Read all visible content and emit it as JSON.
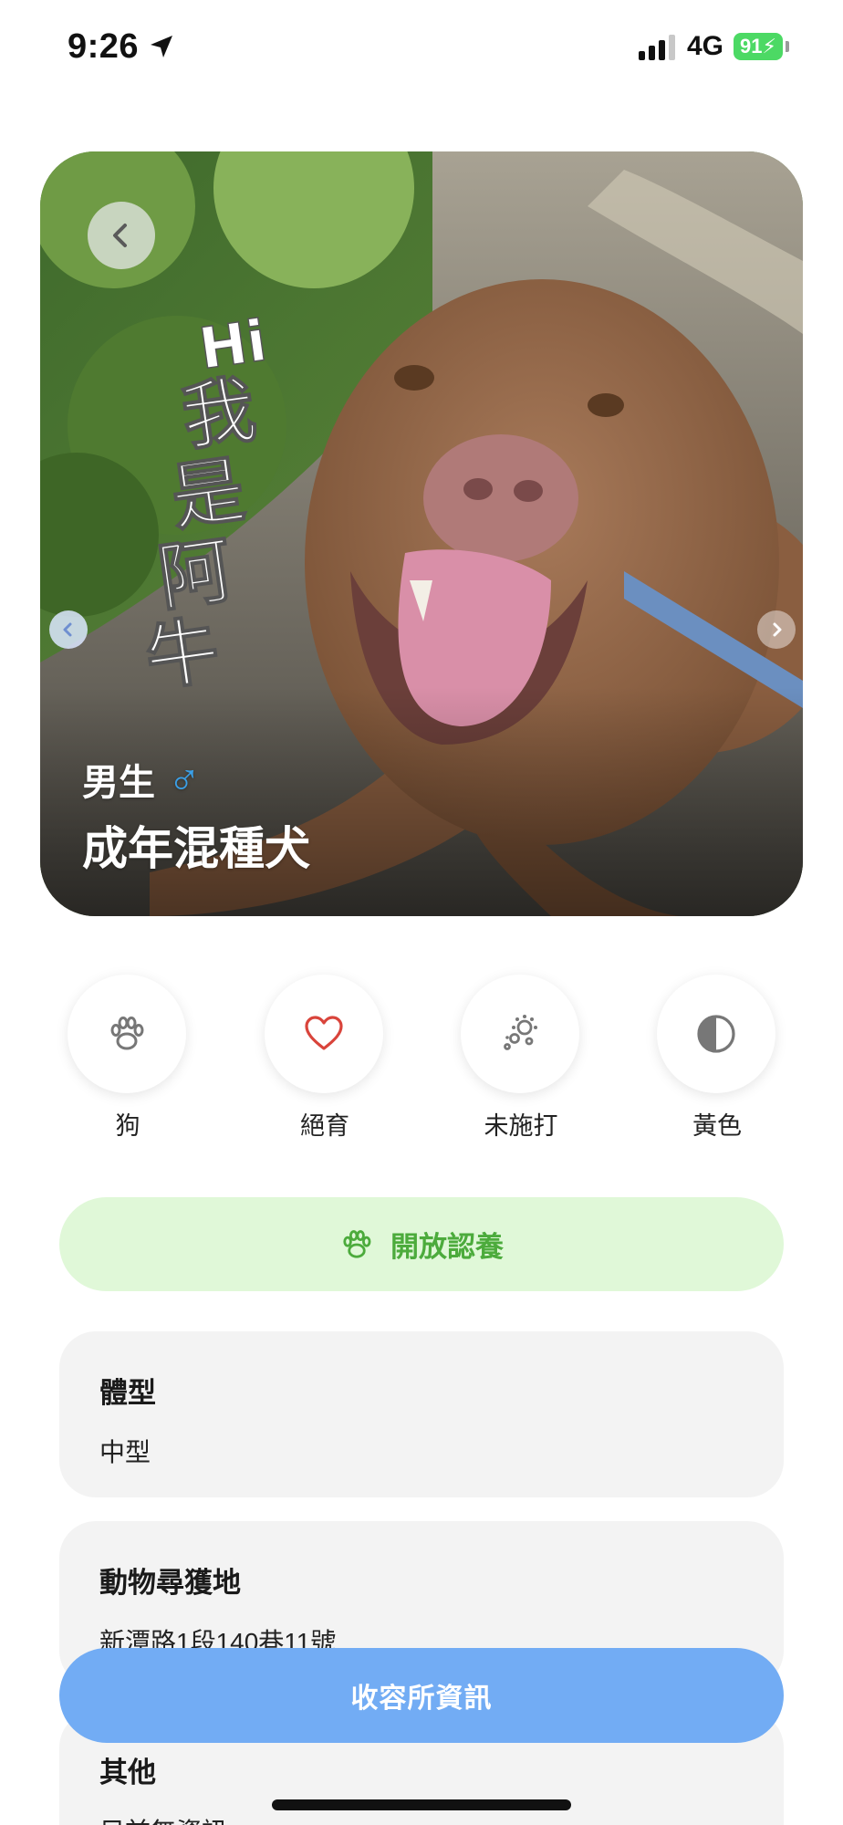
{
  "status_bar": {
    "time": "9:26",
    "network": "4G",
    "battery": "91"
  },
  "hero": {
    "sex": "男生",
    "sex_symbol": "♂",
    "title": "成年混種犬",
    "photo_text": [
      "Hi",
      "我",
      "是",
      "阿",
      "牛"
    ],
    "back_icon": "chevron-left-icon",
    "prev_icon": "chevron-left-icon",
    "next_icon": "chevron-right-icon"
  },
  "attributes": [
    {
      "label": "狗",
      "icon": "paw-icon"
    },
    {
      "label": "絕育",
      "icon": "heart-icon"
    },
    {
      "label": "未施打",
      "icon": "virus-icon"
    },
    {
      "label": "黃色",
      "icon": "half-circle-icon"
    }
  ],
  "adopt": {
    "label": "開放認養",
    "icon": "paw-icon",
    "color": "#4cab3c",
    "background": "#e0f8d8"
  },
  "info": [
    {
      "title": "體型",
      "value": "中型"
    },
    {
      "title": "動物尋獲地",
      "value": "新潭路1段140巷11號"
    },
    {
      "title": "其他",
      "value": "目前無資訊。"
    }
  ],
  "shelter_button": {
    "label": "收容所資訊",
    "color": "#72acf4"
  }
}
